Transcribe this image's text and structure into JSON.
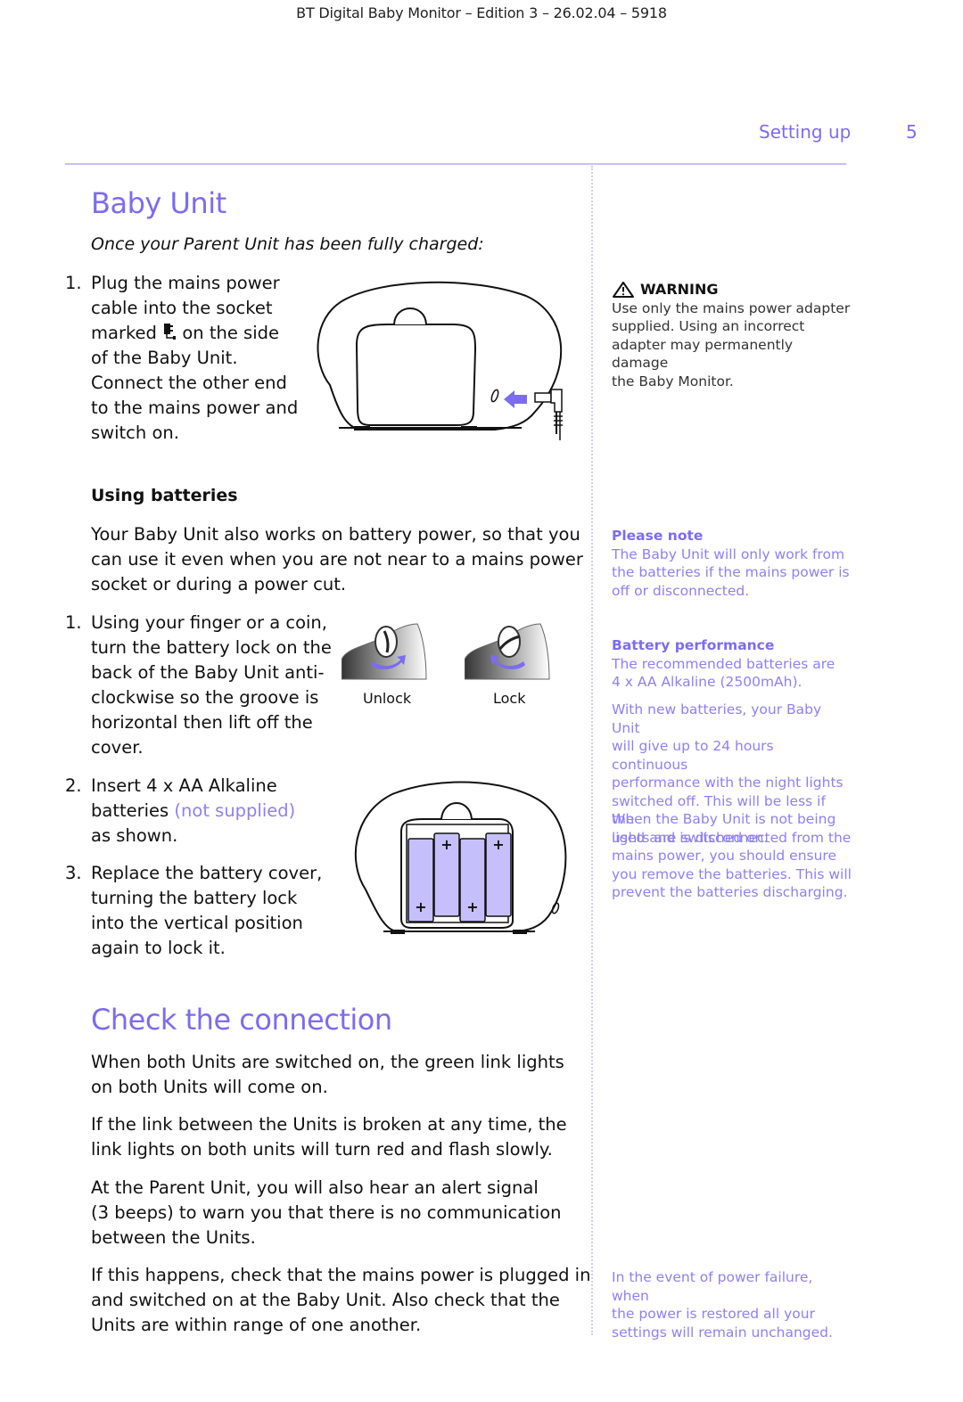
{
  "header": {
    "doc_title": "BT Digital Baby Monitor – Edition 3 – 26.02.04 – 5918",
    "section": "Setting up",
    "page_number": "5"
  },
  "baby_unit": {
    "title": "Baby Unit",
    "intro": "Once your Parent Unit has been fully charged:",
    "mains_step": {
      "number": "1.",
      "lines": [
        "Plug the mains power",
        "cable into the socket",
        "marked",
        "on the side",
        "of the Baby Unit.",
        "Connect the other end",
        "to the mains power and",
        "switch on."
      ]
    },
    "using_batteries": {
      "heading": "Using batteries",
      "intro_lines": [
        "Your Baby Unit also works on battery power, so that you",
        "can use it even when you are not near to a mains power",
        "socket or during a power cut."
      ],
      "steps": [
        {
          "number": "1.",
          "lines": [
            "Using your finger or a coin,",
            "turn the battery lock on the",
            "back of the Baby Unit anti-",
            "clockwise so the groove is",
            "horizontal then lift off the",
            "cover."
          ]
        },
        {
          "number": "2.",
          "lines": [
            "Insert 4 x AA Alkaline",
            "batteries",
            "(not supplied)",
            "as shown."
          ]
        },
        {
          "number": "3.",
          "lines": [
            "Replace the battery cover,",
            "turning the battery lock",
            "into the vertical position",
            "again to lock it."
          ]
        }
      ],
      "lock_captions": {
        "unlock": "Unlock",
        "lock": "Lock"
      }
    }
  },
  "check_connection": {
    "title": "Check the connection",
    "paragraphs": [
      [
        "When both Units are switched on, the green link lights",
        "on both Units will come on."
      ],
      [
        "If the link between the Units is broken at any time, the",
        "link lights on both units will turn red and flash slowly."
      ],
      [
        "At the Parent Unit, you will also hear an alert signal",
        "(3 beeps) to warn you that there is no communication",
        "between the Units."
      ],
      [
        "If this happens, check that the mains power is plugged in",
        "and switched on at the Baby Unit. Also check that the",
        "Units are within range of one another."
      ]
    ]
  },
  "sidebar": {
    "warning": {
      "heading": "WARNING",
      "lines": [
        "Use only the mains power adapter",
        "supplied. Using an incorrect",
        "adapter may permanently damage",
        "the Baby Monitor."
      ]
    },
    "please_note": {
      "heading": "Please note",
      "lines": [
        "The Baby Unit will only work from",
        "the batteries if the mains power is",
        "off or disconnected."
      ]
    },
    "battery_performance": {
      "heading": "Battery performance",
      "lines": [
        "The recommended batteries are",
        "4 x AA Alkaline (2500mAh)."
      ],
      "para2": [
        "With new batteries, your Baby Unit",
        "will give up to 24 hours continuous",
        "performance with the night lights",
        "switched off. This will be less if the",
        "lights are switched on."
      ],
      "para3": [
        "When the Baby Unit is not being",
        "used and is disconnected from the",
        "mains power, you should ensure",
        "you remove the batteries. This will",
        "prevent the batteries discharging."
      ]
    },
    "power_failure": {
      "lines": [
        "In the event of power failure, when",
        "the power is restored all your",
        "settings will remain unchanged."
      ]
    }
  },
  "colors": {
    "accent": "#7b6cf0",
    "accent_light": "#8e80f4",
    "battery_fill": "#c5c0fb",
    "rule": "#cbbef5"
  }
}
